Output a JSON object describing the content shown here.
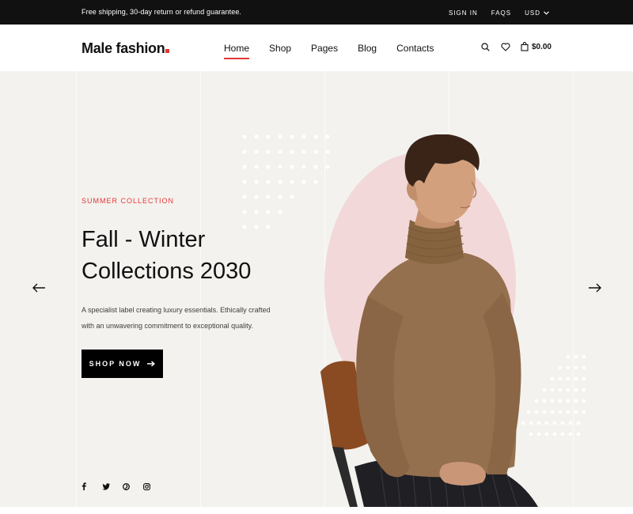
{
  "topbar": {
    "message": "Free shipping, 30-day return or refund guarantee.",
    "sign_in": "SIGN IN",
    "faqs": "FAQS",
    "currency": "USD",
    "currency_icon": "chevron-down-icon"
  },
  "header": {
    "logo_text": "Male fashion",
    "nav": [
      {
        "label": "Home",
        "active": true
      },
      {
        "label": "Shop",
        "active": false
      },
      {
        "label": "Pages",
        "active": false
      },
      {
        "label": "Blog",
        "active": false
      },
      {
        "label": "Contacts",
        "active": false
      }
    ],
    "icons": [
      "search-icon",
      "heart-icon",
      "bag-icon"
    ],
    "cart_total": "$0.00"
  },
  "hero": {
    "label": "SUMMER COLLECTION",
    "title": "Fall - Winter Collections 2030",
    "description": "A specialist label creating luxury essentials. Ethically crafted with an unwavering commitment to exceptional quality.",
    "button_label": "SHOP NOW",
    "button_icon": "arrow-right-icon",
    "prev_icon": "arrow-left-icon",
    "next_icon": "arrow-right-icon",
    "socials": [
      "facebook-icon",
      "twitter-icon",
      "pinterest-icon",
      "instagram-icon"
    ],
    "image": "model-in-brown-turtleneck"
  },
  "colors": {
    "accent": "#e53637",
    "topbar_bg": "#111111",
    "hero_bg": "#f3f2ee",
    "circle": "#f2d8d8",
    "sweater": "#94704f"
  }
}
